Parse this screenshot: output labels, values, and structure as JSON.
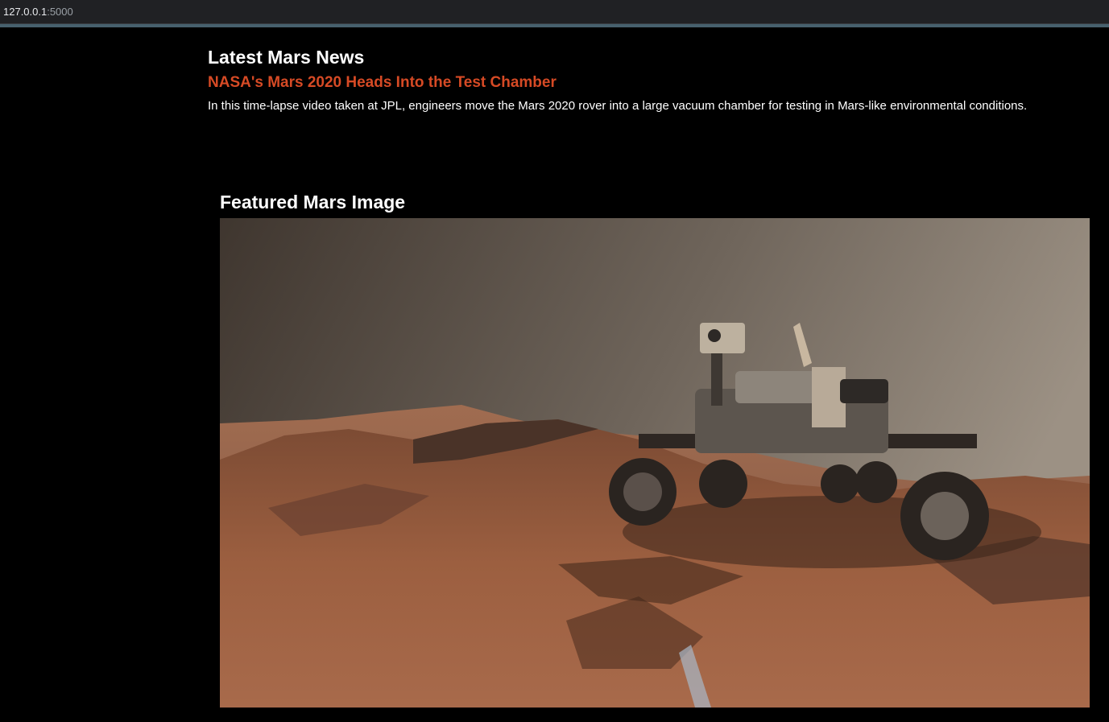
{
  "browser": {
    "address_host": "127.0.0.1",
    "address_port": ":5000"
  },
  "news": {
    "heading": "Latest Mars News",
    "title": "NASA's Mars 2020 Heads Into the Test Chamber",
    "teaser": "In this time-lapse video taken at JPL, engineers move the Mars 2020 rover into a large vacuum chamber for testing in Mars-like environmental conditions."
  },
  "featured_image": {
    "heading": "Featured Mars Image",
    "subject": "Mars rover self-portrait on rocky martian terrain"
  },
  "colors": {
    "page_background": "#000000",
    "headline_accent": "#d64a25",
    "text": "#ffffff"
  }
}
